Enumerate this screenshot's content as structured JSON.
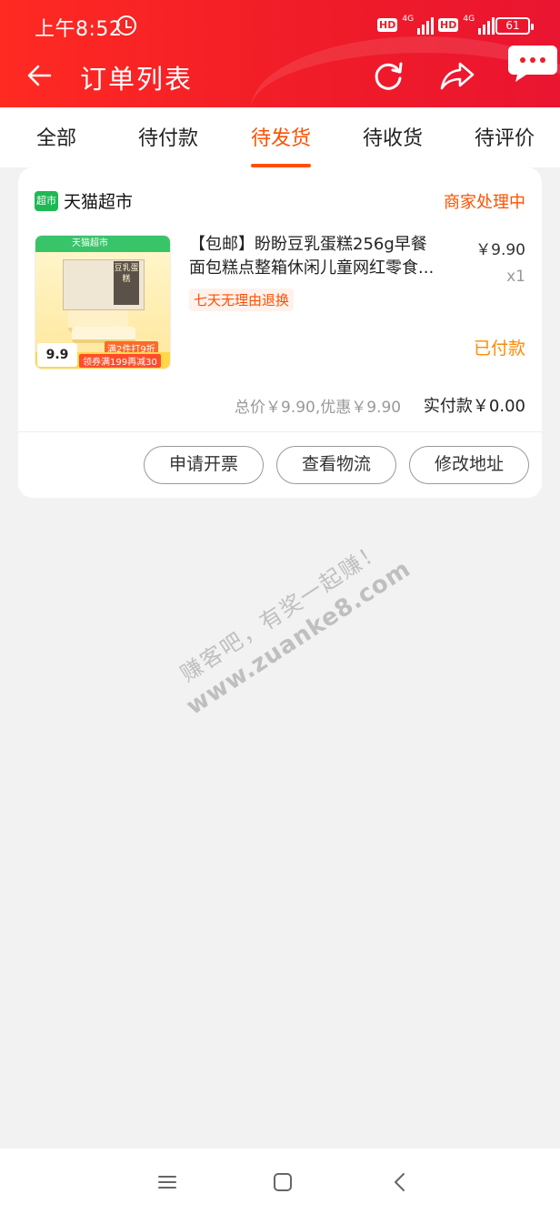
{
  "status_bar": {
    "time": "上午8:52",
    "hd1": "HD",
    "net1": "4G",
    "hd2": "HD",
    "net2": "4G",
    "battery": "61"
  },
  "navbar": {
    "title": "订单列表"
  },
  "tabs": [
    {
      "label": "全部"
    },
    {
      "label": "待付款"
    },
    {
      "label": "待发货"
    },
    {
      "label": "待收货"
    },
    {
      "label": "待评价"
    }
  ],
  "active_tab": "待发货",
  "order": {
    "shop_logo_text": "超市",
    "shop_name": "天猫超市",
    "status": "商家处理中",
    "product": {
      "title_line1": "【包邮】盼盼豆乳蛋糕256g早餐",
      "title_line2": "面包糕点整箱休闲儿童网红零食...",
      "return_policy": "七天无理由退换",
      "unit_price": "￥9.90",
      "quantity": "x1",
      "thumb_top_text": "天猫超市",
      "thumb_box_text": "豆乳蛋糕",
      "thumb_promo": "满2件打9折",
      "thumb_coupon": "领券满199再减30",
      "thumb_price": "9.9"
    },
    "payment_status": "已付款",
    "total_info": "总价￥9.90,优惠￥9.90",
    "actual_payment": "实付款￥0.00",
    "actions": [
      {
        "label": "申请开票"
      },
      {
        "label": "查看物流"
      },
      {
        "label": "修改地址"
      }
    ]
  },
  "watermark": {
    "line1": "赚客吧，有奖一起赚！",
    "line2": "www.zuanke8.com"
  },
  "colors": {
    "header": "#f01c28",
    "accent": "#ff5000",
    "paid": "#ff8a00"
  }
}
